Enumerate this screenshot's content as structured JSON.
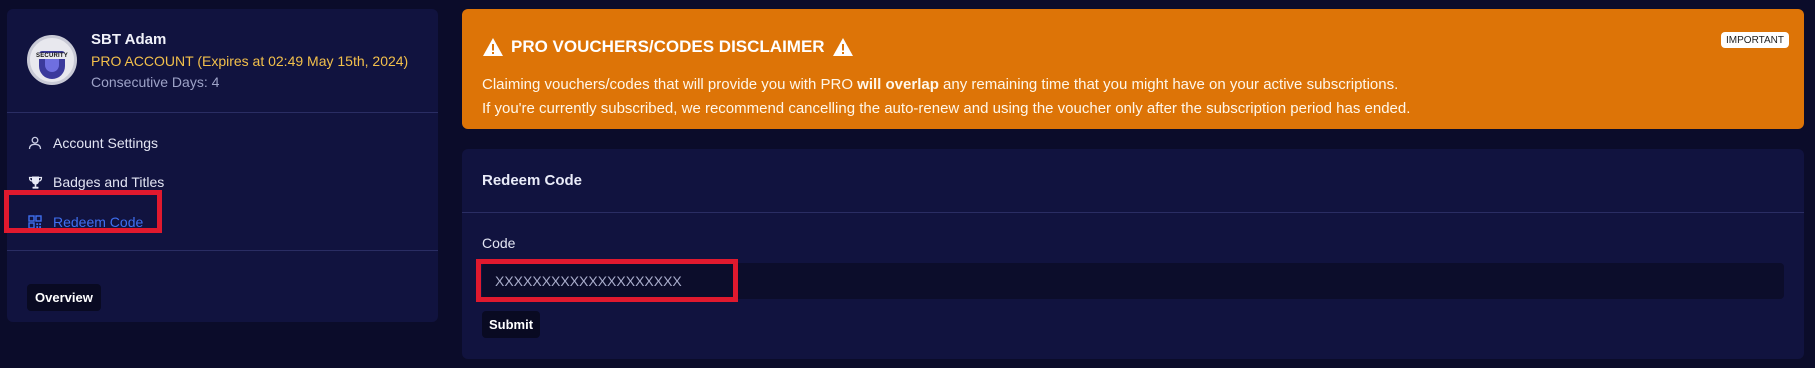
{
  "profile": {
    "name": "SBT Adam",
    "plan": "PRO ACCOUNT (Expires at 02:49 May 15th, 2024)",
    "streak": "Consecutive Days: 4",
    "avatar_text": "SECURITY",
    "avatar_icon": "shield-badge"
  },
  "sidebar": {
    "items": [
      {
        "label": "Account Settings",
        "icon": "user-icon",
        "active": false
      },
      {
        "label": "Badges and Titles",
        "icon": "trophy-icon",
        "active": false
      },
      {
        "label": "Redeem Code",
        "icon": "qr-code-icon",
        "active": true
      }
    ],
    "overview_label": "Overview"
  },
  "disclaimer": {
    "title": "PRO VOUCHERS/CODES DISCLAIMER",
    "badge": "IMPORTANT",
    "line1_prefix": "Claiming vouchers/codes that will provide you with PRO ",
    "line1_bold": "will overlap",
    "line1_suffix": " any remaining time that you might have on your active subscriptions.",
    "line2": "If you're currently subscribed, we recommend cancelling the auto-renew and using the voucher only after the subscription period has ended.",
    "icon": "warning-icon"
  },
  "redeem": {
    "title": "Redeem Code",
    "code_label": "Code",
    "code_placeholder": "XXXXXXXXXXXXXXXXXXXX",
    "submit_label": "Submit"
  },
  "colors": {
    "background": "#0b0c2a",
    "panel": "#11133f",
    "accent": "#3f6ff0",
    "warning": "#dd7407",
    "pro": "#f3c04b",
    "highlight": "#e0192e"
  }
}
